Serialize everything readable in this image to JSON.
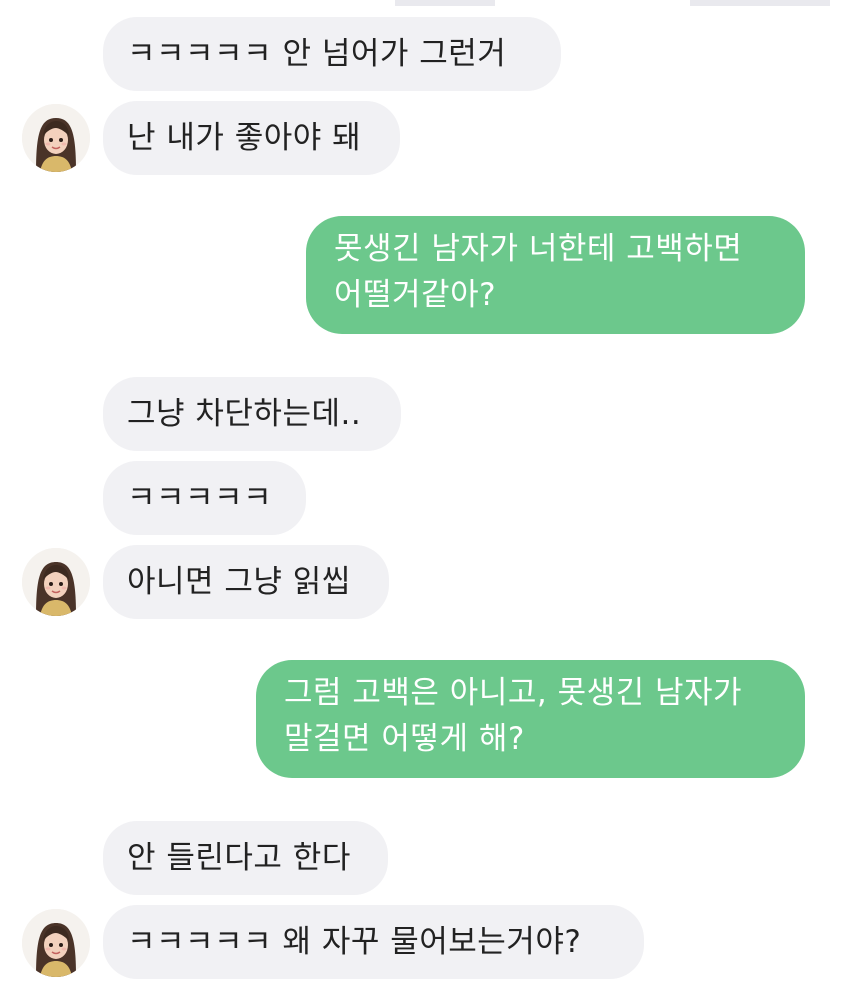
{
  "conversation": {
    "messages": [
      {
        "id": "m1",
        "from": "other",
        "text": "ㅋㅋㅋㅋㅋ 안 넘어가 그런거"
      },
      {
        "id": "m2",
        "from": "other",
        "text": "난 내가 좋아야 돼",
        "avatar": true
      },
      {
        "id": "m3",
        "from": "me",
        "lines": [
          "못생긴 남자가 너한테 고백하면",
          "어떨거같아?"
        ]
      },
      {
        "id": "m4",
        "from": "other",
        "text": "그냥 차단하는데.."
      },
      {
        "id": "m5",
        "from": "other",
        "text": "ㅋㅋㅋㅋㅋ"
      },
      {
        "id": "m6",
        "from": "other",
        "text": "아니면 그냥 읽씹",
        "avatar": true
      },
      {
        "id": "m7",
        "from": "me",
        "lines": [
          "그럼 고백은 아니고, 못생긴 남자가",
          "말걸면 어떻게 해?"
        ]
      },
      {
        "id": "m8",
        "from": "other",
        "text": "안 들린다고 한다"
      },
      {
        "id": "m9",
        "from": "other",
        "text": "ㅋㅋㅋㅋㅋ 왜 자꾸 물어보는거야?",
        "avatar": true
      }
    ]
  },
  "colors": {
    "incoming_bubble": "#f1f1f4",
    "outgoing_bubble": "#6cc88c",
    "incoming_text": "#222222",
    "outgoing_text": "#ffffff"
  },
  "icons": {
    "avatar": "girl-portrait-avatar-icon"
  }
}
